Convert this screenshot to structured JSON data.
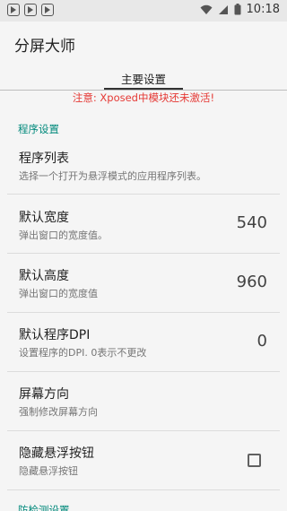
{
  "status_bar": {
    "time": "10:18",
    "left_icons": [
      "app-notification-icon",
      "app-notification-icon",
      "app-notification-icon"
    ],
    "right_icons": [
      "wifi-icon",
      "signal-icon",
      "battery-icon"
    ]
  },
  "app_bar": {
    "title": "分屏大师"
  },
  "tabs": [
    {
      "label": "主要设置",
      "selected": true
    }
  ],
  "warning": {
    "text": "注意: Xposed中模块还未激活!",
    "color": "#e53935"
  },
  "sections": [
    {
      "header": "程序设置"
    },
    {
      "header": "防检测设置"
    }
  ],
  "preferences": [
    {
      "title": "程序列表",
      "summary": "选择一个打开为悬浮模式的应用程序列表。",
      "value": ""
    },
    {
      "title": "默认宽度",
      "summary": "弹出窗口的宽度值。",
      "value": "540"
    },
    {
      "title": "默认高度",
      "summary": "弹出窗口的宽度值",
      "value": "960"
    },
    {
      "title": "默认程序DPI",
      "summary": "设置程序的DPI. 0表示不更改",
      "value": "0"
    },
    {
      "title": "屏幕方向",
      "summary": "强制修改屏幕方向",
      "value": ""
    },
    {
      "title": "隐藏悬浮按钮",
      "summary": "隐藏悬浮按钮",
      "checked": false
    }
  ],
  "colors": {
    "accent": "#00897b",
    "warning": "#e53935",
    "background": "#f5f5f5"
  }
}
